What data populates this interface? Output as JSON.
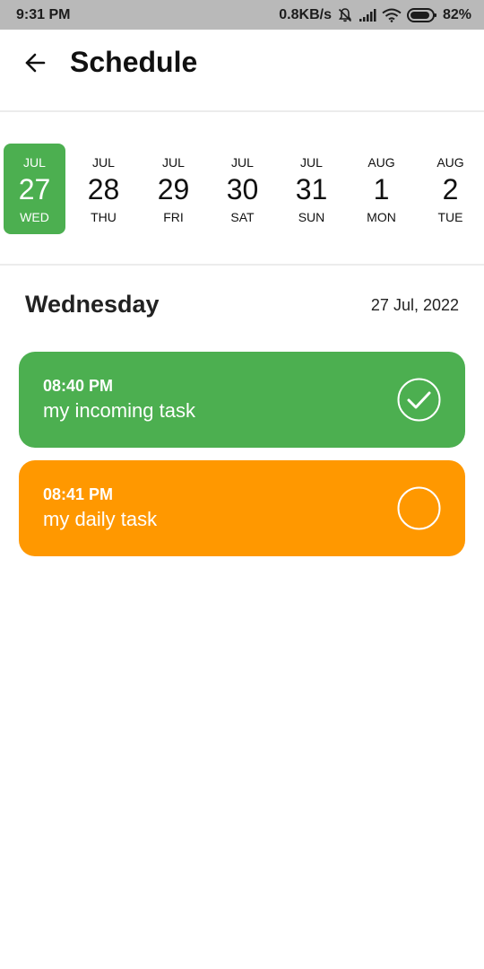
{
  "status_bar": {
    "time": "9:31 PM",
    "network_speed": "0.8KB/s",
    "battery": "82%",
    "icons": [
      "mute-bell-icon",
      "signal-icon",
      "wifi-icon",
      "battery-icon"
    ]
  },
  "app_bar": {
    "back_icon": "arrow-left-icon",
    "title": "Schedule"
  },
  "dates": [
    {
      "month": "JUL",
      "day": "27",
      "weekday": "WED",
      "selected": true
    },
    {
      "month": "JUL",
      "day": "28",
      "weekday": "THU",
      "selected": false
    },
    {
      "month": "JUL",
      "day": "29",
      "weekday": "FRI",
      "selected": false
    },
    {
      "month": "JUL",
      "day": "30",
      "weekday": "SAT",
      "selected": false
    },
    {
      "month": "JUL",
      "day": "31",
      "weekday": "SUN",
      "selected": false
    },
    {
      "month": "AUG",
      "day": "1",
      "weekday": "MON",
      "selected": false
    },
    {
      "month": "AUG",
      "day": "2",
      "weekday": "TUE",
      "selected": false
    }
  ],
  "selected_day": {
    "heading": "Wednesday",
    "date": "27 Jul, 2022"
  },
  "tasks": [
    {
      "time": "08:40 PM",
      "title": "my incoming task",
      "completed": true,
      "color": "#4caf50"
    },
    {
      "time": "08:41 PM",
      "title": "my daily task",
      "completed": false,
      "color": "#ff9800"
    }
  ],
  "colors": {
    "accent": "#4caf50",
    "pending": "#ff9800",
    "status_bar": "#b9b9b9"
  }
}
